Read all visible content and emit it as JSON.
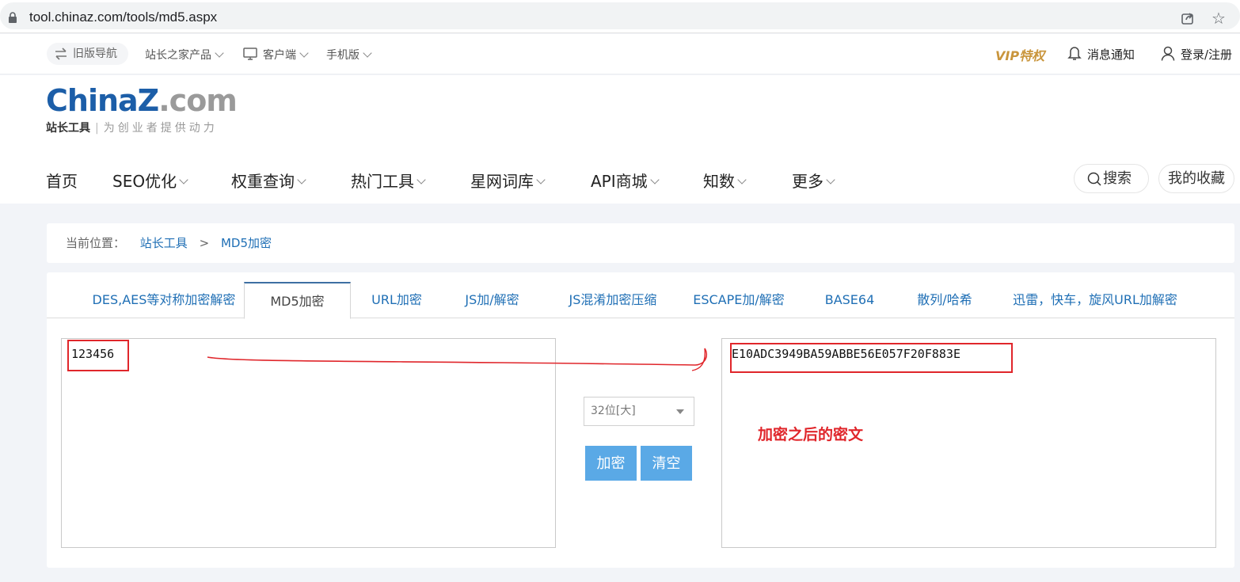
{
  "browser": {
    "url": "tool.chinaz.com/tools/md5.aspx"
  },
  "topbar": {
    "old_nav": "旧版导航",
    "products": "站长之家产品",
    "client": "客户端",
    "mobile": "手机版",
    "vip": "VIP特权",
    "notifications": "消息通知",
    "login": "登录/注册"
  },
  "logo": {
    "china": "China",
    "z": "Z",
    "com": ".com",
    "sub_bold": "站长工具",
    "sub_rest": "为创业者提供动力"
  },
  "nav": {
    "items": [
      "首页",
      "SEO优化",
      "权重查询",
      "热门工具",
      "星网词库",
      "API商城",
      "知数",
      "更多"
    ],
    "search": "搜索",
    "favorites": "我的收藏"
  },
  "breadcrumb": {
    "prefix": "当前位置：",
    "root": "站长工具",
    "separator": ">",
    "current": "MD5加密"
  },
  "tabs": [
    "DES,AES等对称加密解密",
    "MD5加密",
    "URL加密",
    "JS加/解密",
    "JS混淆加密压缩",
    "ESCAPE加/解密",
    "BASE64",
    "散列/哈希",
    "迅雷，快车，旋风URL加解密"
  ],
  "tool": {
    "input_value": "123456",
    "output_value": "E10ADC3949BA59ABBE56E057F20F883E",
    "select_value": "32位[大]",
    "encrypt_label": "加密",
    "clear_label": "清空"
  },
  "annotation": {
    "text": "加密之后的密文",
    "color": "#e0262b"
  },
  "colors": {
    "link": "#1f6fb5",
    "button": "#5aa9e6",
    "brand": "#1c5ea8"
  }
}
